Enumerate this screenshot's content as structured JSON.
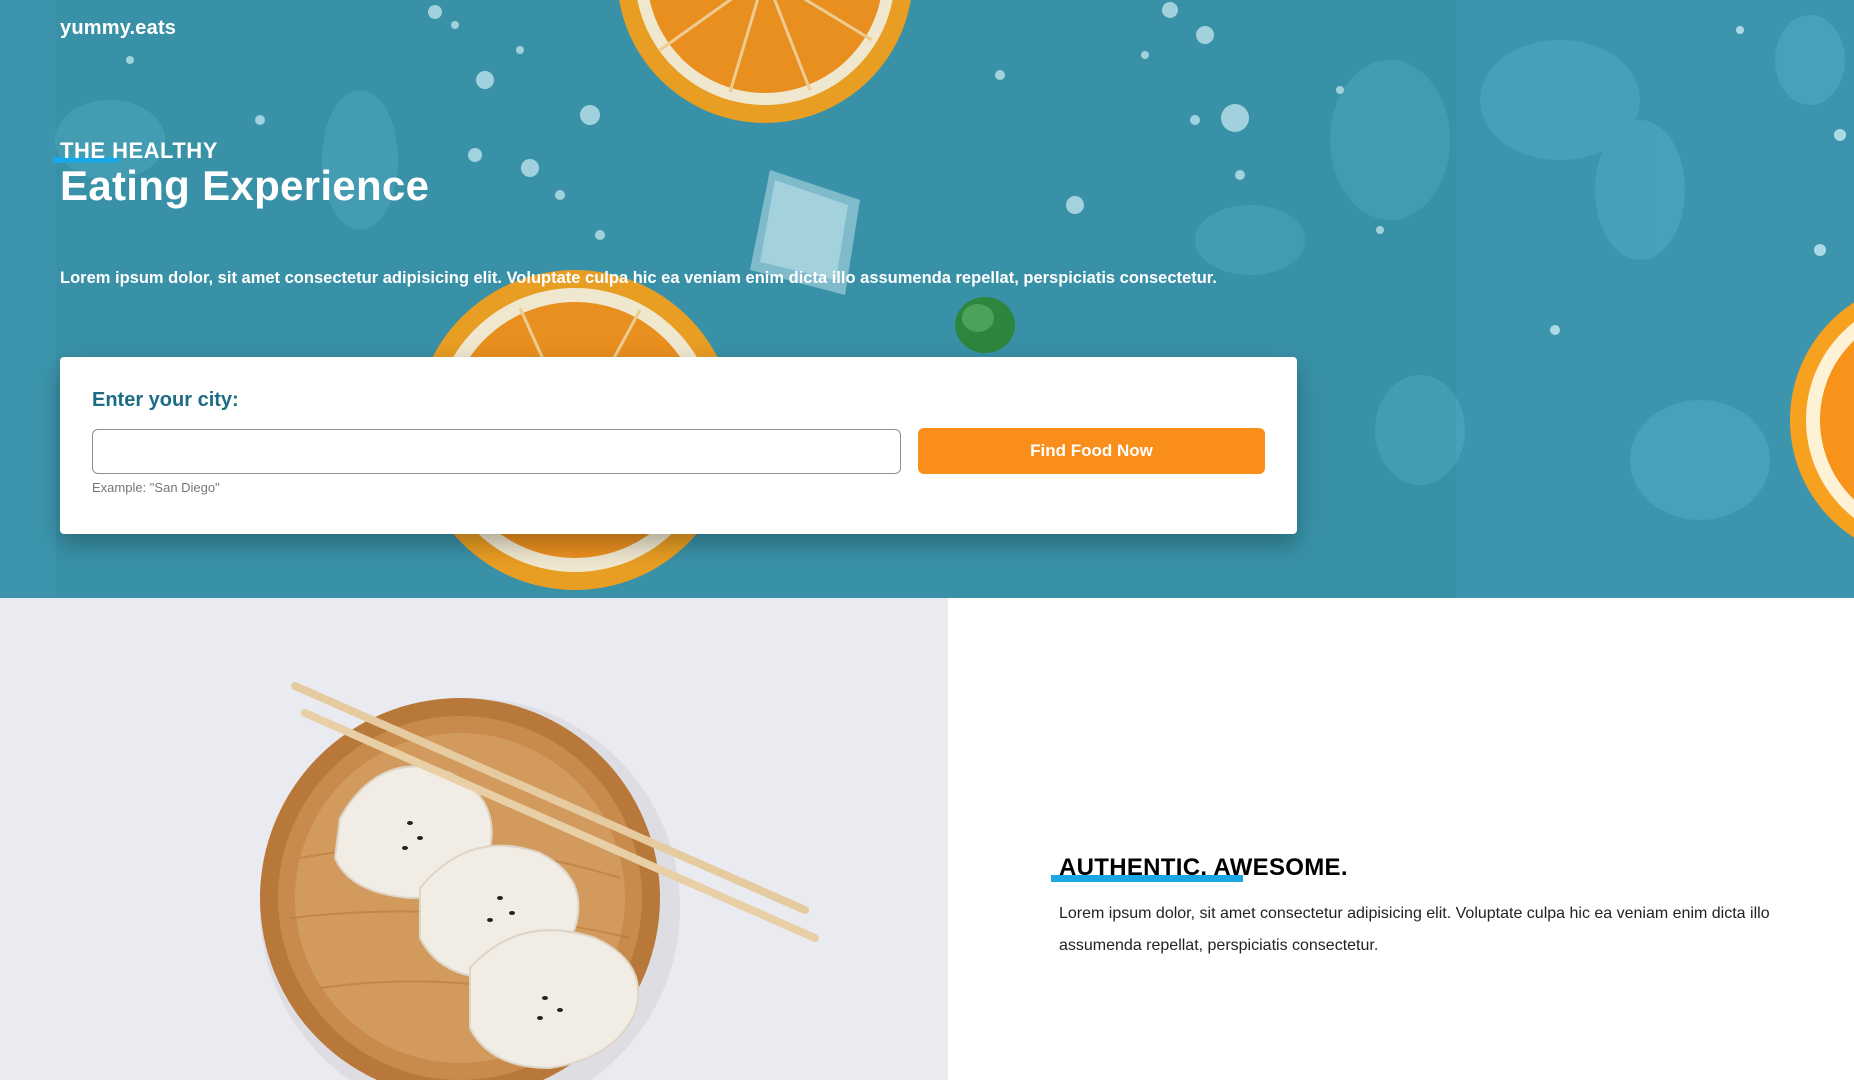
{
  "brand": {
    "name": "yummy.eats"
  },
  "hero": {
    "eyebrow": "THE HEALTHY",
    "title": "Eating Experience",
    "description": "Lorem ipsum dolor, sit amet consectetur adipisicing elit. Voluptate culpa hic ea veniam enim dicta illo assumenda repellat, perspiciatis consectetur."
  },
  "search": {
    "label": "Enter your city:",
    "input_value": "",
    "placeholder": "",
    "hint": "Example: \"San Diego\"",
    "button_label": "Find Food Now"
  },
  "feature": {
    "heading": "AUTHENTIC. AWESOME.",
    "description": "Lorem ipsum dolor, sit amet consectetur adipisicing elit. Voluptate culpa hic ea veniam enim dicta illo assumenda repellat, perspiciatis consectetur."
  },
  "colors": {
    "hero_background": "#3c95ac",
    "accent_blue": "#1aa7e4",
    "button_orange": "#f98e1a",
    "label_teal": "#1c6c84"
  },
  "images": {
    "hero": "orange-slices-ice-water-drops-photo",
    "feature": "dumplings-wooden-plate-chopsticks-photo"
  }
}
